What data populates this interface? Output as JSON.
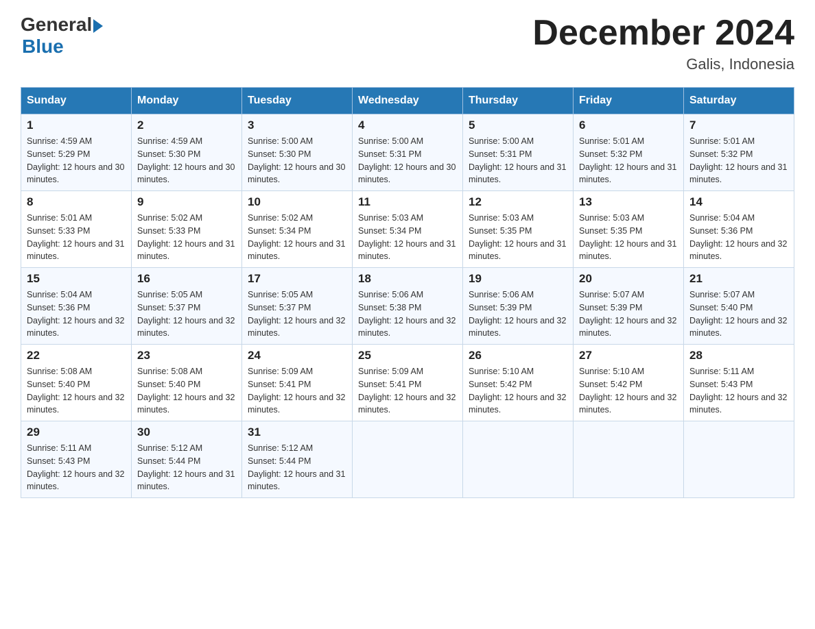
{
  "header": {
    "logo": {
      "general": "General",
      "arrow": "▶",
      "blue": "Blue"
    },
    "title": "December 2024",
    "location": "Galis, Indonesia"
  },
  "calendar": {
    "days_of_week": [
      "Sunday",
      "Monday",
      "Tuesday",
      "Wednesday",
      "Thursday",
      "Friday",
      "Saturday"
    ],
    "weeks": [
      [
        {
          "day": "1",
          "sunrise": "Sunrise: 4:59 AM",
          "sunset": "Sunset: 5:29 PM",
          "daylight": "Daylight: 12 hours and 30 minutes."
        },
        {
          "day": "2",
          "sunrise": "Sunrise: 4:59 AM",
          "sunset": "Sunset: 5:30 PM",
          "daylight": "Daylight: 12 hours and 30 minutes."
        },
        {
          "day": "3",
          "sunrise": "Sunrise: 5:00 AM",
          "sunset": "Sunset: 5:30 PM",
          "daylight": "Daylight: 12 hours and 30 minutes."
        },
        {
          "day": "4",
          "sunrise": "Sunrise: 5:00 AM",
          "sunset": "Sunset: 5:31 PM",
          "daylight": "Daylight: 12 hours and 30 minutes."
        },
        {
          "day": "5",
          "sunrise": "Sunrise: 5:00 AM",
          "sunset": "Sunset: 5:31 PM",
          "daylight": "Daylight: 12 hours and 31 minutes."
        },
        {
          "day": "6",
          "sunrise": "Sunrise: 5:01 AM",
          "sunset": "Sunset: 5:32 PM",
          "daylight": "Daylight: 12 hours and 31 minutes."
        },
        {
          "day": "7",
          "sunrise": "Sunrise: 5:01 AM",
          "sunset": "Sunset: 5:32 PM",
          "daylight": "Daylight: 12 hours and 31 minutes."
        }
      ],
      [
        {
          "day": "8",
          "sunrise": "Sunrise: 5:01 AM",
          "sunset": "Sunset: 5:33 PM",
          "daylight": "Daylight: 12 hours and 31 minutes."
        },
        {
          "day": "9",
          "sunrise": "Sunrise: 5:02 AM",
          "sunset": "Sunset: 5:33 PM",
          "daylight": "Daylight: 12 hours and 31 minutes."
        },
        {
          "day": "10",
          "sunrise": "Sunrise: 5:02 AM",
          "sunset": "Sunset: 5:34 PM",
          "daylight": "Daylight: 12 hours and 31 minutes."
        },
        {
          "day": "11",
          "sunrise": "Sunrise: 5:03 AM",
          "sunset": "Sunset: 5:34 PM",
          "daylight": "Daylight: 12 hours and 31 minutes."
        },
        {
          "day": "12",
          "sunrise": "Sunrise: 5:03 AM",
          "sunset": "Sunset: 5:35 PM",
          "daylight": "Daylight: 12 hours and 31 minutes."
        },
        {
          "day": "13",
          "sunrise": "Sunrise: 5:03 AM",
          "sunset": "Sunset: 5:35 PM",
          "daylight": "Daylight: 12 hours and 31 minutes."
        },
        {
          "day": "14",
          "sunrise": "Sunrise: 5:04 AM",
          "sunset": "Sunset: 5:36 PM",
          "daylight": "Daylight: 12 hours and 32 minutes."
        }
      ],
      [
        {
          "day": "15",
          "sunrise": "Sunrise: 5:04 AM",
          "sunset": "Sunset: 5:36 PM",
          "daylight": "Daylight: 12 hours and 32 minutes."
        },
        {
          "day": "16",
          "sunrise": "Sunrise: 5:05 AM",
          "sunset": "Sunset: 5:37 PM",
          "daylight": "Daylight: 12 hours and 32 minutes."
        },
        {
          "day": "17",
          "sunrise": "Sunrise: 5:05 AM",
          "sunset": "Sunset: 5:37 PM",
          "daylight": "Daylight: 12 hours and 32 minutes."
        },
        {
          "day": "18",
          "sunrise": "Sunrise: 5:06 AM",
          "sunset": "Sunset: 5:38 PM",
          "daylight": "Daylight: 12 hours and 32 minutes."
        },
        {
          "day": "19",
          "sunrise": "Sunrise: 5:06 AM",
          "sunset": "Sunset: 5:39 PM",
          "daylight": "Daylight: 12 hours and 32 minutes."
        },
        {
          "day": "20",
          "sunrise": "Sunrise: 5:07 AM",
          "sunset": "Sunset: 5:39 PM",
          "daylight": "Daylight: 12 hours and 32 minutes."
        },
        {
          "day": "21",
          "sunrise": "Sunrise: 5:07 AM",
          "sunset": "Sunset: 5:40 PM",
          "daylight": "Daylight: 12 hours and 32 minutes."
        }
      ],
      [
        {
          "day": "22",
          "sunrise": "Sunrise: 5:08 AM",
          "sunset": "Sunset: 5:40 PM",
          "daylight": "Daylight: 12 hours and 32 minutes."
        },
        {
          "day": "23",
          "sunrise": "Sunrise: 5:08 AM",
          "sunset": "Sunset: 5:40 PM",
          "daylight": "Daylight: 12 hours and 32 minutes."
        },
        {
          "day": "24",
          "sunrise": "Sunrise: 5:09 AM",
          "sunset": "Sunset: 5:41 PM",
          "daylight": "Daylight: 12 hours and 32 minutes."
        },
        {
          "day": "25",
          "sunrise": "Sunrise: 5:09 AM",
          "sunset": "Sunset: 5:41 PM",
          "daylight": "Daylight: 12 hours and 32 minutes."
        },
        {
          "day": "26",
          "sunrise": "Sunrise: 5:10 AM",
          "sunset": "Sunset: 5:42 PM",
          "daylight": "Daylight: 12 hours and 32 minutes."
        },
        {
          "day": "27",
          "sunrise": "Sunrise: 5:10 AM",
          "sunset": "Sunset: 5:42 PM",
          "daylight": "Daylight: 12 hours and 32 minutes."
        },
        {
          "day": "28",
          "sunrise": "Sunrise: 5:11 AM",
          "sunset": "Sunset: 5:43 PM",
          "daylight": "Daylight: 12 hours and 32 minutes."
        }
      ],
      [
        {
          "day": "29",
          "sunrise": "Sunrise: 5:11 AM",
          "sunset": "Sunset: 5:43 PM",
          "daylight": "Daylight: 12 hours and 32 minutes."
        },
        {
          "day": "30",
          "sunrise": "Sunrise: 5:12 AM",
          "sunset": "Sunset: 5:44 PM",
          "daylight": "Daylight: 12 hours and 31 minutes."
        },
        {
          "day": "31",
          "sunrise": "Sunrise: 5:12 AM",
          "sunset": "Sunset: 5:44 PM",
          "daylight": "Daylight: 12 hours and 31 minutes."
        },
        null,
        null,
        null,
        null
      ]
    ]
  }
}
